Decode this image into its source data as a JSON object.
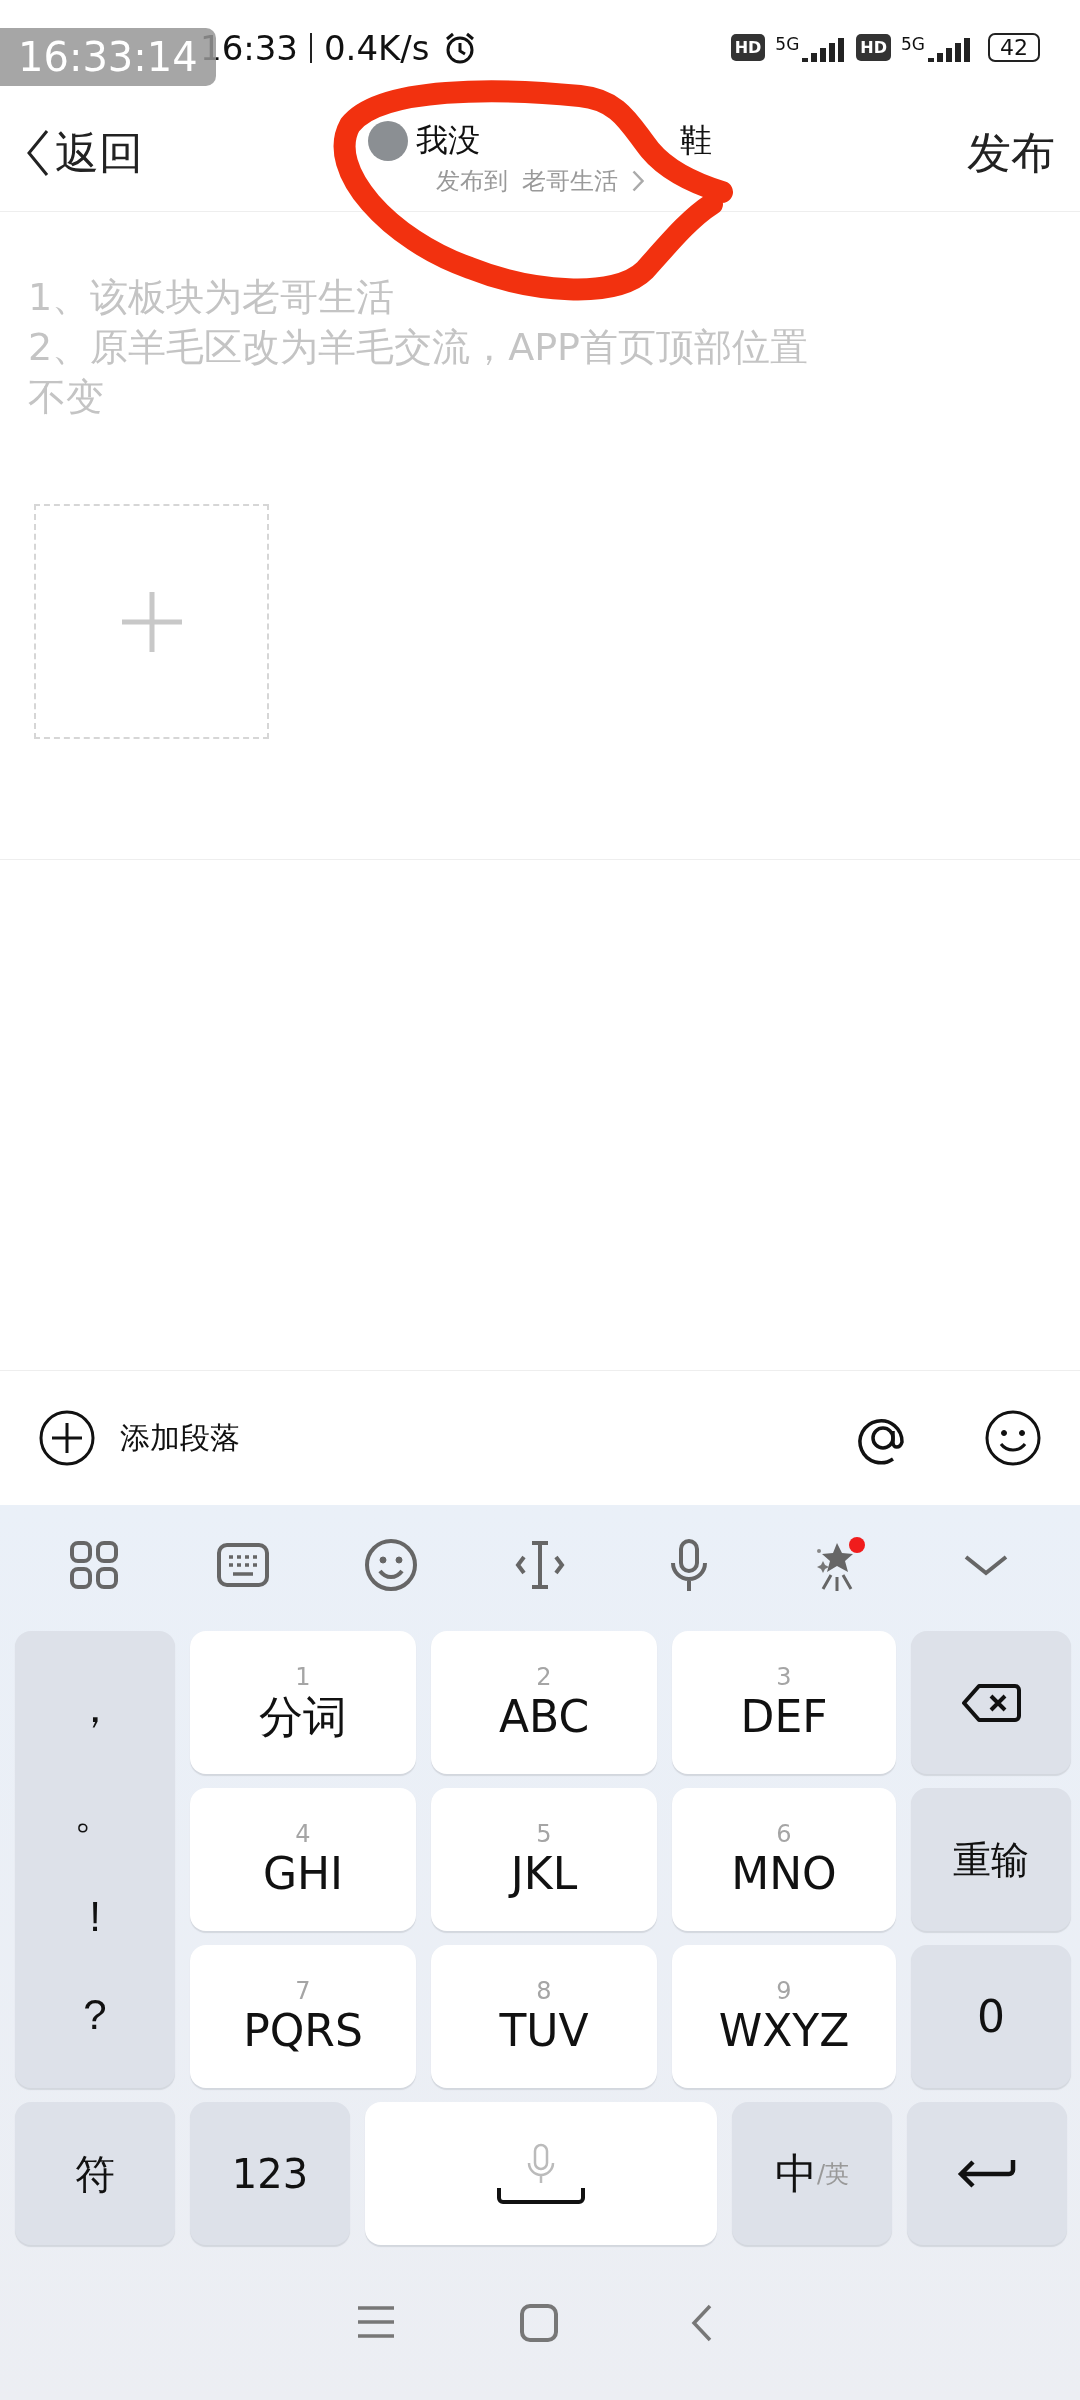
{
  "recorder_badge": "16:33:14",
  "status_bar": {
    "time": "16:33",
    "speed": "0.4K/s",
    "sims": [
      {
        "hd": "HD",
        "network": "5G"
      },
      {
        "hd": "HD",
        "network": "5G"
      }
    ],
    "battery": "42"
  },
  "header": {
    "back": "返回",
    "title_start": "我没",
    "title_end": "鞋",
    "subtitle_prefix": "发布到",
    "board": "老哥生活",
    "action": "发布"
  },
  "annotation": {
    "kind": "scribble",
    "color": "#f2310f"
  },
  "editor": {
    "placeholder": "1、该板块为老哥生活\n2、原羊毛区改为羊毛交流，APP首页顶部位置不变"
  },
  "action_bar": {
    "add_paragraph": "添加段落"
  },
  "keyboard": {
    "effects_dot": true,
    "punctuation": [
      "，",
      "。",
      "!",
      "?"
    ],
    "keys": [
      {
        "number": "1",
        "label": "分词"
      },
      {
        "number": "2",
        "label": "ABC"
      },
      {
        "number": "3",
        "label": "DEF"
      },
      {
        "number": "4",
        "label": "GHI"
      },
      {
        "number": "5",
        "label": "JKL"
      },
      {
        "number": "6",
        "label": "MNO"
      },
      {
        "number": "7",
        "label": "PQRS"
      },
      {
        "number": "8",
        "label": "TUV"
      },
      {
        "number": "9",
        "label": "WXYZ"
      }
    ],
    "retype": "重输",
    "zero": "0",
    "symbols": "符",
    "numbers": "123",
    "lang_main": "中",
    "lang_alt": "/英"
  }
}
